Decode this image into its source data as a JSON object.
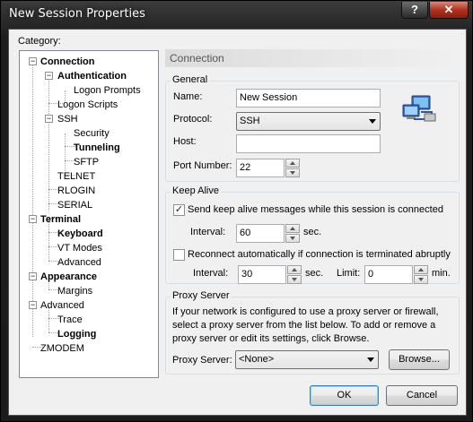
{
  "window": {
    "title": "New Session Properties",
    "help_label": "?",
    "close_label": "✕"
  },
  "category_label": "Category:",
  "tree": {
    "connection": "Connection",
    "authentication": "Authentication",
    "logon_prompts": "Logon Prompts",
    "logon_scripts": "Logon Scripts",
    "ssh": "SSH",
    "security": "Security",
    "tunneling": "Tunneling",
    "sftp": "SFTP",
    "telnet": "TELNET",
    "rlogin": "RLOGIN",
    "serial": "SERIAL",
    "terminal": "Terminal",
    "keyboard": "Keyboard",
    "vt_modes": "VT Modes",
    "advanced_terminal": "Advanced",
    "appearance": "Appearance",
    "margins": "Margins",
    "advanced": "Advanced",
    "trace": "Trace",
    "logging": "Logging",
    "zmodem": "ZMODEM",
    "expanded_symbol": "−"
  },
  "panel_title": "Connection",
  "general": {
    "legend": "General",
    "name_label": "Name:",
    "name_value": "New Session",
    "protocol_label": "Protocol:",
    "protocol_value": "SSH",
    "host_label": "Host:",
    "host_value": "",
    "port_label": "Port Number:",
    "port_value": "22",
    "icon": "network-computers-icon"
  },
  "keep_alive": {
    "legend": "Keep Alive",
    "send_label": "Send keep alive messages while this session is connected",
    "send_checked": "✓",
    "interval_label": "Interval:",
    "interval_value": "60",
    "interval_unit": "sec.",
    "reconnect_label": "Reconnect automatically if connection is terminated abruptly",
    "reconnect_checked": "",
    "reconnect_interval_label": "Interval:",
    "reconnect_interval_value": "30",
    "reconnect_interval_unit": "sec.",
    "limit_label": "Limit:",
    "limit_value": "0",
    "limit_unit": "min."
  },
  "proxy": {
    "legend": "Proxy Server",
    "description": "If your network is configured to use a proxy server or firewall, select a proxy server from the list below. To add or remove a proxy server or edit its settings, click Browse.",
    "proxy_label": "Proxy Server:",
    "proxy_value": "<None>",
    "browse_label": "Browse..."
  },
  "buttons": {
    "ok": "OK",
    "cancel": "Cancel"
  },
  "colors": {
    "title_bg": "#1e1e1e",
    "close_red": "#b0321f",
    "client_bg": "#f0f0f0"
  }
}
